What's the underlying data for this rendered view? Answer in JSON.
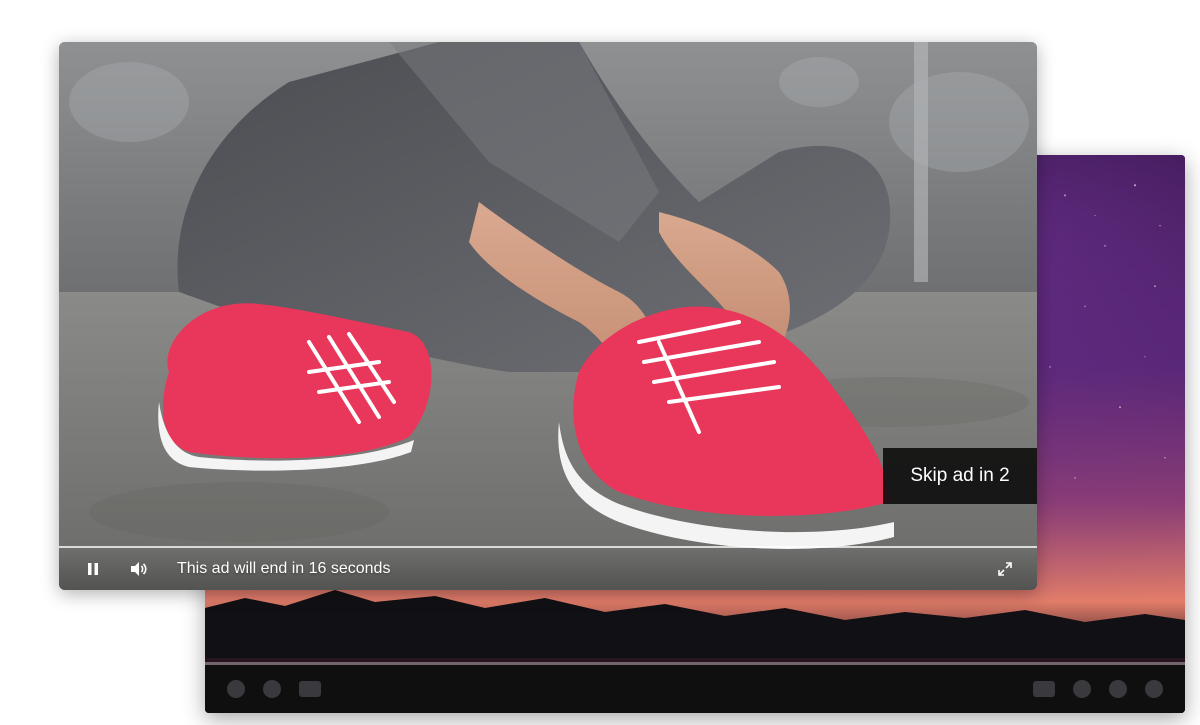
{
  "ad_player": {
    "skip_label": "Skip ad in 2",
    "message": "This ad will end in 16 seconds",
    "controls": {
      "pause_icon": "pause-icon",
      "volume_icon": "volume-icon",
      "fullscreen_icon": "fullscreen-icon"
    }
  },
  "colors": {
    "shoe": "#e8375a",
    "skip_bg": "#0a0a0a",
    "rear_player_sky_top": "#2a0f3d",
    "rear_player_sunset": "#e27d69"
  }
}
